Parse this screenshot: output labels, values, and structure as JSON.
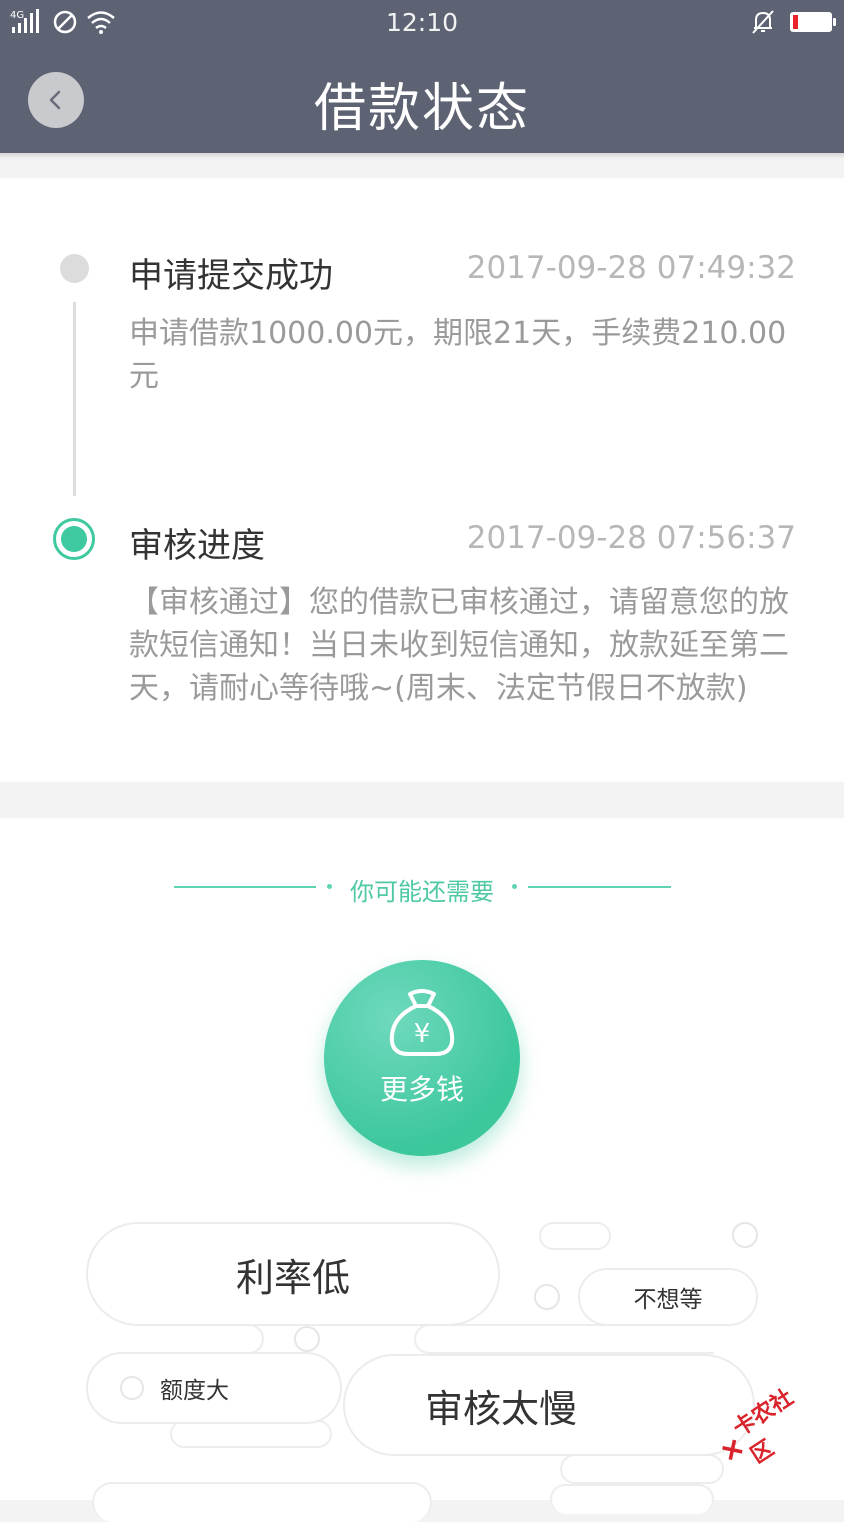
{
  "status_bar": {
    "time": "12:10",
    "network": "4G",
    "icons": [
      "signal-icon",
      "no-sim-icon",
      "wifi-icon",
      "bell-muted-icon",
      "battery-low-icon"
    ],
    "battery_level": 0.15,
    "battery_color": "#e8232a"
  },
  "header": {
    "title": "借款状态",
    "back_icon": "chevron-left-icon",
    "background": "#5e6374"
  },
  "timeline": {
    "steps": [
      {
        "title": "申请提交成功",
        "time": "2017-09-28 07:49:32",
        "description": "申请借款1000.00元，期限21天，手续费210.00元",
        "state": "done"
      },
      {
        "title": "审核进度",
        "time": "2017-09-28 07:56:37",
        "description": "【审核通过】您的借款已审核通过，请留意您的放款短信通知！当日未收到短信通知，放款延至第二天，请耐心等待哦~(周末、法定节假日不放款)",
        "state": "current"
      }
    ],
    "accent": "#3ec9a0"
  },
  "recommend": {
    "heading": "你可能还需要",
    "main_button": {
      "label": "更多钱",
      "icon": "money-bag-icon"
    },
    "bubbles": {
      "low_rate": "利率低",
      "no_wait": "不想等",
      "large_amount": "额度大",
      "slow_review": "审核太慢"
    }
  },
  "watermark": {
    "text": "卡农社区"
  }
}
